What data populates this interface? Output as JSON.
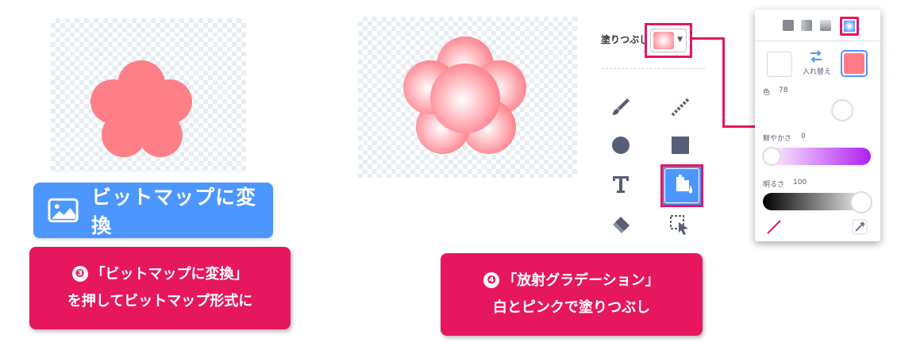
{
  "left_panel": {
    "convert_button_label": "ビットマップに変換",
    "note_num": "❸",
    "note_line1": "「ビットマップに変換」",
    "note_line2": "を押してビットマップ形式に"
  },
  "right_panel": {
    "fill_label": "塗りつぶし",
    "note_num": "❹",
    "note_line1": "「放射グラデーション」",
    "note_line2": "白とピンクで塗りつぶし"
  },
  "popup": {
    "swap_label": "入れ替え",
    "color_label": "色",
    "color_value": "78",
    "saturation_label": "鮮やかさ",
    "saturation_value": "0",
    "brightness_label": "明るさ",
    "brightness_value": "100"
  },
  "colors": {
    "accent": "#e6175f",
    "button_blue": "#4c97ff",
    "flower_pink": "#ff7a86",
    "gradient_purple": "#b01ff2"
  }
}
